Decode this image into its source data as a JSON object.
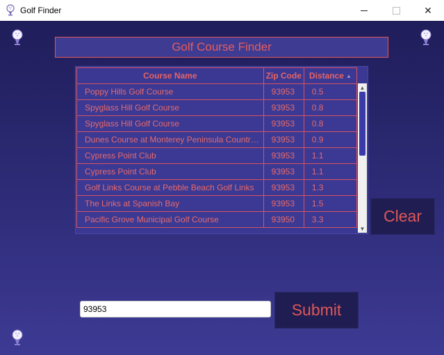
{
  "window": {
    "title": "Golf Finder",
    "close_glyph": "✕",
    "icons": [
      "golf-ball-icon",
      "minimize-icon",
      "maximize-icon",
      "close-icon"
    ]
  },
  "header": {
    "title": "Golf Course Finder"
  },
  "table": {
    "columns": [
      "Course Name",
      "Zip Code",
      "Distance"
    ],
    "sort_indicator": "▲",
    "rows": [
      {
        "name": "Poppy Hills Golf Course",
        "zip": "93953",
        "distance": "0.5"
      },
      {
        "name": "Spyglass Hill Golf Course",
        "zip": "93953",
        "distance": "0.8"
      },
      {
        "name": "Spyglass Hill Golf Course",
        "zip": "93953",
        "distance": "0.8"
      },
      {
        "name": "Dunes Course at Monterey Peninsula Country ...",
        "zip": "93953",
        "distance": "0.9"
      },
      {
        "name": "Cypress Point Club",
        "zip": "93953",
        "distance": "1.1"
      },
      {
        "name": "Cypress Point Club",
        "zip": "93953",
        "distance": "1.1"
      },
      {
        "name": "Golf Links Course at Pebble Beach Golf Links",
        "zip": "93953",
        "distance": "1.3"
      },
      {
        "name": "The Links at Spanish Bay",
        "zip": "93953",
        "distance": "1.5"
      },
      {
        "name": "Pacific Grove Municipal Golf Course",
        "zip": "93950",
        "distance": "3.3"
      }
    ]
  },
  "buttons": {
    "clear": "Clear",
    "submit": "Submit"
  },
  "search": {
    "value": "93953"
  },
  "colors": {
    "accent": "#e05757",
    "background_top": "#1f1d5a",
    "background_bottom": "#3d3a94",
    "button_bg": "#1f1d52"
  }
}
